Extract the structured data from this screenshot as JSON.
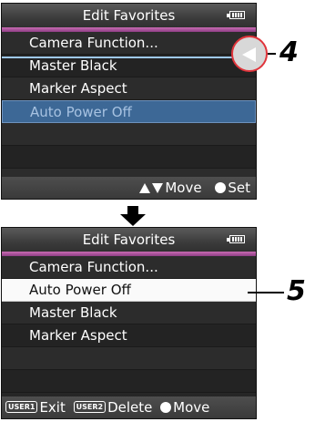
{
  "screen_top": {
    "title": "Edit Favorites",
    "items": [
      "Camera Function...",
      "Master Black",
      "Marker Aspect",
      "Auto Power Off"
    ],
    "hint_move": "Move",
    "hint_set": "Set"
  },
  "screen_bottom": {
    "title": "Edit Favorites",
    "items": [
      "Camera Function...",
      "Auto Power Off",
      "Master Black",
      "Marker Aspect"
    ],
    "user1_label": "USER1",
    "user1_action": "Exit",
    "user2_label": "USER2",
    "user2_action": "Delete",
    "hint_move": "Move"
  },
  "callouts": {
    "step_a": "4",
    "step_b": "5"
  },
  "colors": {
    "selected_top": "#3d6896",
    "selected_bottom": "#fafafa",
    "title_accent": "#b25aa4",
    "callout_circle": "#e0343b"
  }
}
